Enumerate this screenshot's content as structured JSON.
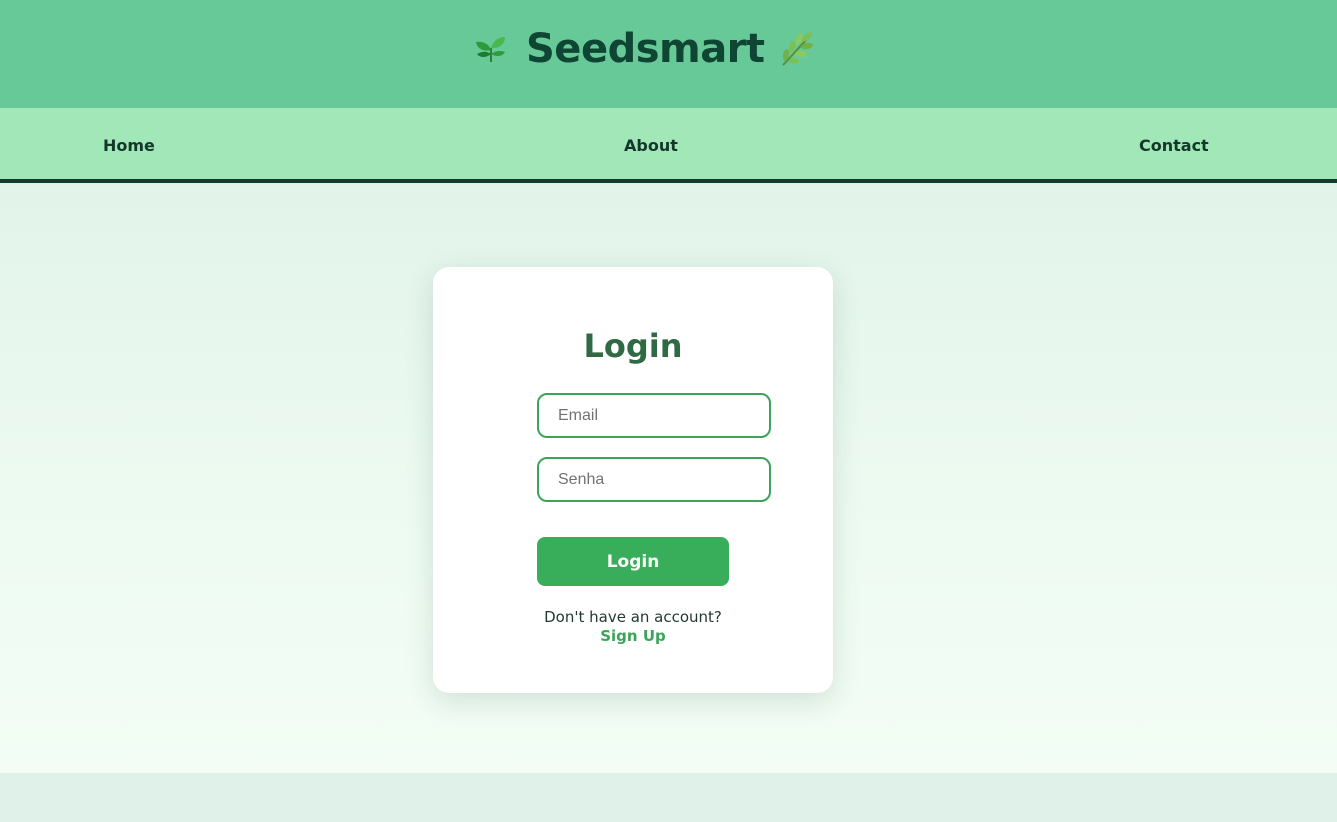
{
  "header": {
    "brand_title": "Seedsmart",
    "left_icon": "seedling-icon",
    "right_icon": "herb-icon"
  },
  "nav": {
    "items": [
      {
        "label": "Home"
      },
      {
        "label": "About"
      },
      {
        "label": "Contact"
      }
    ]
  },
  "login_card": {
    "title": "Login",
    "email_placeholder": "Email",
    "email_value": "",
    "password_placeholder": "Senha",
    "password_value": "",
    "submit_label": "Login",
    "signup_prompt": "Don't have an account?",
    "signup_link": "Sign Up"
  },
  "colors": {
    "header_bg": "#68c998",
    "nav_bg": "#a2e7b7",
    "nav_border": "#123d2e",
    "accent": "#38ae5a",
    "title_green": "#2f6a44",
    "brand_dark": "#0f4533"
  }
}
